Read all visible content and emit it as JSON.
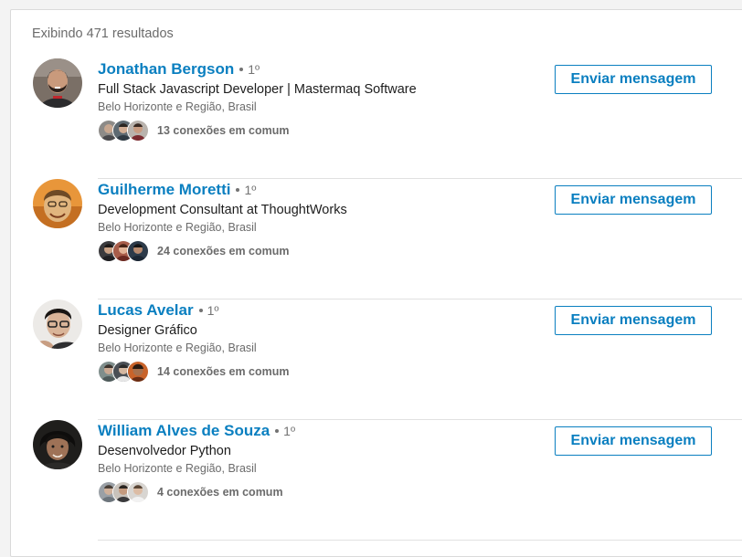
{
  "results": {
    "count_label": "Exibindo 471 resultados"
  },
  "people": [
    {
      "name": "Jonathan Bergson",
      "degree": "1º",
      "headline": "Full Stack Javascript Developer | Mastermaq Software",
      "location": "Belo Horizonte e Região, Brasil",
      "shared_connections": "13 conexões em comum",
      "action_label": "Enviar mensagem"
    },
    {
      "name": "Guilherme Moretti",
      "degree": "1º",
      "headline": "Development Consultant at ThoughtWorks",
      "location": "Belo Horizonte e Região, Brasil",
      "shared_connections": "24 conexões em comum",
      "action_label": "Enviar mensagem"
    },
    {
      "name": "Lucas Avelar",
      "degree": "1º",
      "headline": "Designer Gráfico",
      "location": "Belo Horizonte e Região, Brasil",
      "shared_connections": "14 conexões em comum",
      "action_label": "Enviar mensagem"
    },
    {
      "name": "William Alves de Souza",
      "degree": "1º",
      "headline": "Desenvolvedor Python",
      "location": "Belo Horizonte e Região, Brasil",
      "shared_connections": "4 conexões em comum",
      "action_label": "Enviar mensagem"
    }
  ],
  "colors": {
    "link_blue": "#0a7fc0",
    "muted_text": "#6b6b6b",
    "divider": "#e1e1e1"
  }
}
